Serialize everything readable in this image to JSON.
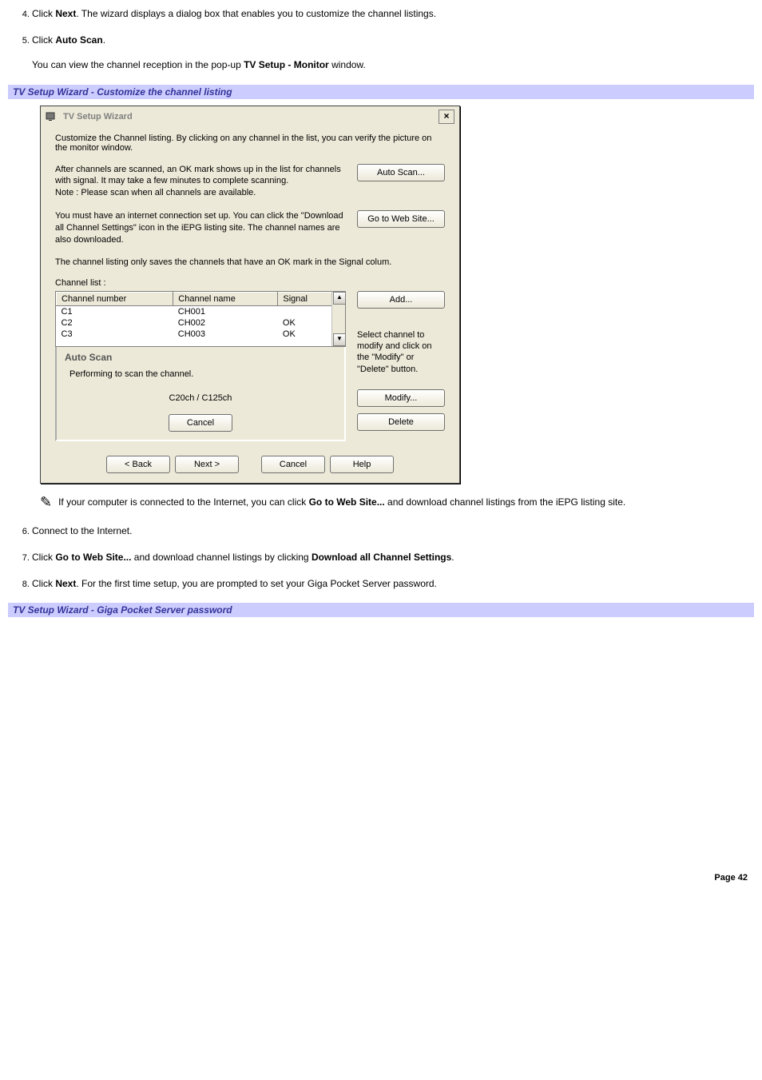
{
  "steps": {
    "s4": {
      "pre": "Click ",
      "bold": "Next",
      "post": ". The wizard displays a dialog box that enables you to customize the channel listings."
    },
    "s5": {
      "pre": "Click ",
      "bold": "Auto Scan",
      "post": ".",
      "sub_pre": "You can view the channel reception in the pop-up ",
      "sub_bold": "TV Setup - Monitor",
      "sub_post": " window."
    },
    "s6": "Connect to the Internet.",
    "s7": {
      "pre": "Click ",
      "b1": "Go to Web Site...",
      "mid": " and download channel listings by clicking ",
      "b2": "Download all Channel Settings",
      "post": "."
    },
    "s8": {
      "pre": "Click ",
      "b1": "Next",
      "post": ". For the first time setup, you are prompted to set your Giga Pocket Server password."
    }
  },
  "section1_title": "TV Setup Wizard - Customize the channel listing",
  "section2_title": "TV Setup Wizard - Giga Pocket Server password",
  "dialog": {
    "title": "TV Setup Wizard",
    "close": "×",
    "intro": "Customize the Channel listing. By clicking on any channel in the list, you can verify the picture on the monitor window.",
    "scan_text_l1": "After channels are scanned, an OK mark shows up in the list for channels with signal. It may take a few minutes to complete scanning.",
    "scan_text_l2": "Note : Please scan when all channels are available.",
    "auto_scan_btn": "Auto Scan...",
    "web_text": "You must have an internet connection set up. You can click the \"Download all Channel Settings\" icon in the iEPG listing site. The channel names are also downloaded.",
    "web_btn": "Go to Web Site...",
    "save_note": "The channel listing only saves the channels that have an OK mark in the Signal colum.",
    "list_label": "Channel list :",
    "cols": {
      "num": "Channel number",
      "name": "Channel name",
      "sig": "Signal"
    },
    "rows": [
      {
        "num": "C1",
        "name": "CH001",
        "sig": ""
      },
      {
        "num": "C2",
        "name": "CH002",
        "sig": "OK"
      },
      {
        "num": "C3",
        "name": "CH003",
        "sig": "OK"
      }
    ],
    "add_btn": "Add...",
    "hint": "Select channel to modify and click on the \"Modify\" or \"Delete\" button.",
    "modify_btn": "Modify...",
    "delete_btn": "Delete",
    "autoscan": {
      "title": "Auto Scan",
      "msg": "Performing to scan the channel.",
      "progress": "C20ch / C125ch",
      "cancel": "Cancel"
    },
    "nav": {
      "back": "< Back",
      "next": "Next >",
      "cancel": "Cancel",
      "help": "Help"
    }
  },
  "tip": {
    "pre": "If your computer is connected to the Internet, you can click ",
    "bold": "Go to Web Site...",
    "post": " and download channel listings from the iEPG listing site."
  },
  "page_num": "Page 42"
}
